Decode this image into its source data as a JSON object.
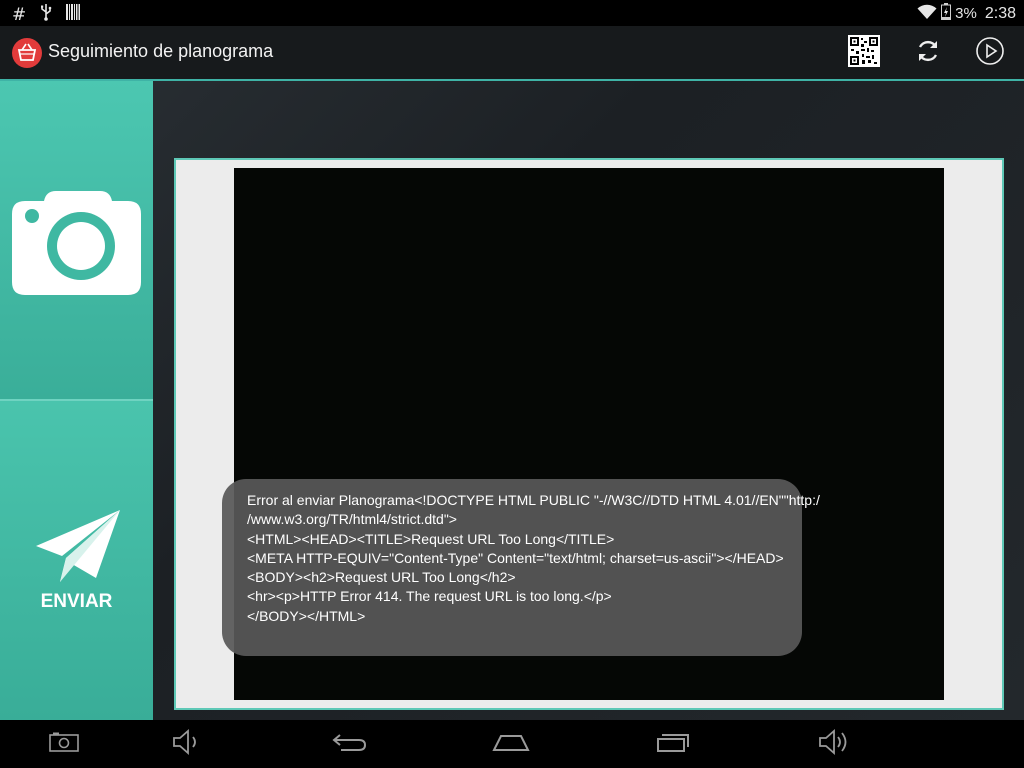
{
  "status_bar": {
    "left_icons": [
      "hash-icon",
      "usb-icon",
      "barcode-icon"
    ],
    "wifi_icon": "wifi-icon",
    "battery_icon": "battery-charging-icon",
    "battery": "3%",
    "time": "2:38"
  },
  "action_bar": {
    "title": "Seguimiento de planograma",
    "actions": [
      "qr-code-icon",
      "refresh-icon",
      "play-circle-icon"
    ],
    "accent_color": "#3fb3a6"
  },
  "side_panel": {
    "camera_icon": "camera-icon",
    "send_label": "ENVIAR",
    "send_icon": "paper-plane-icon",
    "color": "#3cb59f"
  },
  "toast": {
    "lines": [
      "Error al enviar Planograma<!DOCTYPE HTML PUBLIC \"-//W3C//DTD HTML 4.01//EN\"\"http:/",
      "/www.w3.org/TR/html4/strict.dtd\">",
      "<HTML><HEAD><TITLE>Request URL Too Long</TITLE>",
      "<META HTTP-EQUIV=\"Content-Type\" Content=\"text/html; charset=us-ascii\"></HEAD>",
      "<BODY><h2>Request URL Too Long</h2>",
      "<hr><p>HTTP Error 414. The request URL is too long.</p>",
      "</BODY></HTML>"
    ]
  },
  "nav_bar": {
    "buttons": [
      "screenshot-icon",
      "volume-down-icon",
      "back-icon",
      "home-icon",
      "recent-apps-icon",
      "volume-up-icon"
    ]
  }
}
